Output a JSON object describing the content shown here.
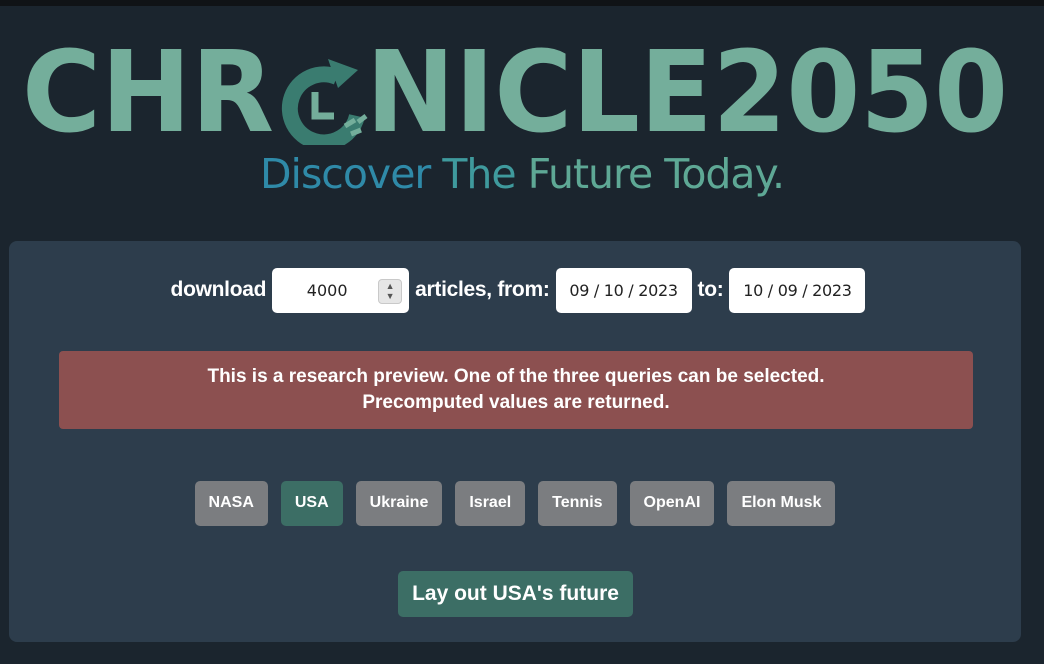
{
  "brand": {
    "logo_text": "CHRONICLE2050",
    "color": "#74ae9b",
    "tagline_parts": [
      "Discover",
      "The",
      "Future Today."
    ],
    "tagline_colors": [
      "#2f8aa8",
      "#3f9a9d",
      "#5ea895"
    ]
  },
  "query": {
    "download_label": "download",
    "article_count": "4000",
    "articles_from_label": "articles, from:",
    "from_date": "09 / 10 / 2023",
    "to_label": "to:",
    "to_date": "10 / 09 / 2023"
  },
  "notice": {
    "line1": "This is a research preview. One of the three queries can be selected.",
    "line2": "Precomputed values are returned.",
    "color": "#8c5050"
  },
  "topics": {
    "items": [
      "NASA",
      "USA",
      "Ukraine",
      "Israel",
      "Tennis",
      "OpenAI",
      "Elon Musk"
    ],
    "selected": "USA",
    "selected_color": "#3c6e65",
    "default_color": "#7b7d80"
  },
  "action": {
    "label": "Lay out USA's future"
  }
}
